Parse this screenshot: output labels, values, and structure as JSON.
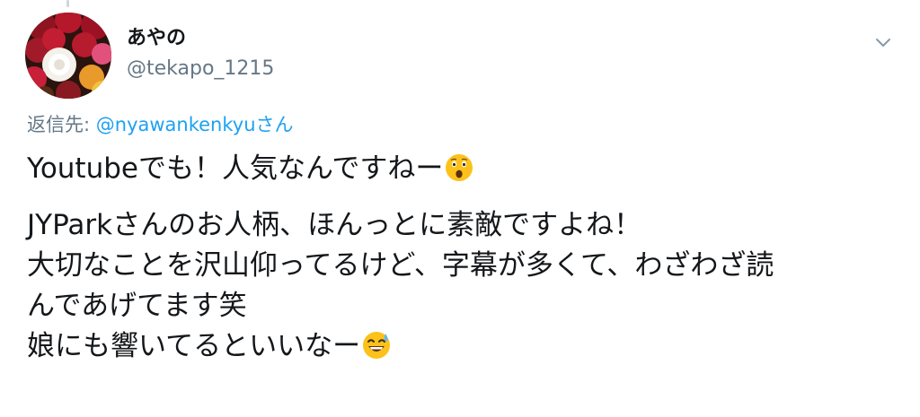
{
  "user": {
    "display_name": "あやの",
    "handle": "@tekapo_1215",
    "avatar_icon": "rose-bouquet-avatar-icon"
  },
  "reply": {
    "prefix": "返信先: ",
    "mention": "@nyawankenkyuさん"
  },
  "tweet": {
    "paragraph1": {
      "line1": "Youtubeでも！人気なんですねー"
    },
    "paragraph2": {
      "line1": "JYParkさんのお人柄、ほんっとに素敵ですよね！",
      "line2": "大切なことを沢山仰ってるけど、字幕が多くて、わざわざ読",
      "line3": "んであげてます笑",
      "line4": "娘にも響いてるといいなー"
    }
  },
  "icons": {
    "more": "chevron-down-icon",
    "emoji1": "hushed-face-emoji-icon",
    "emoji2": "grinning-face-with-sweat-emoji-icon"
  },
  "colors": {
    "text": "#14171a",
    "secondary": "#657786",
    "link": "#1da1f2"
  }
}
